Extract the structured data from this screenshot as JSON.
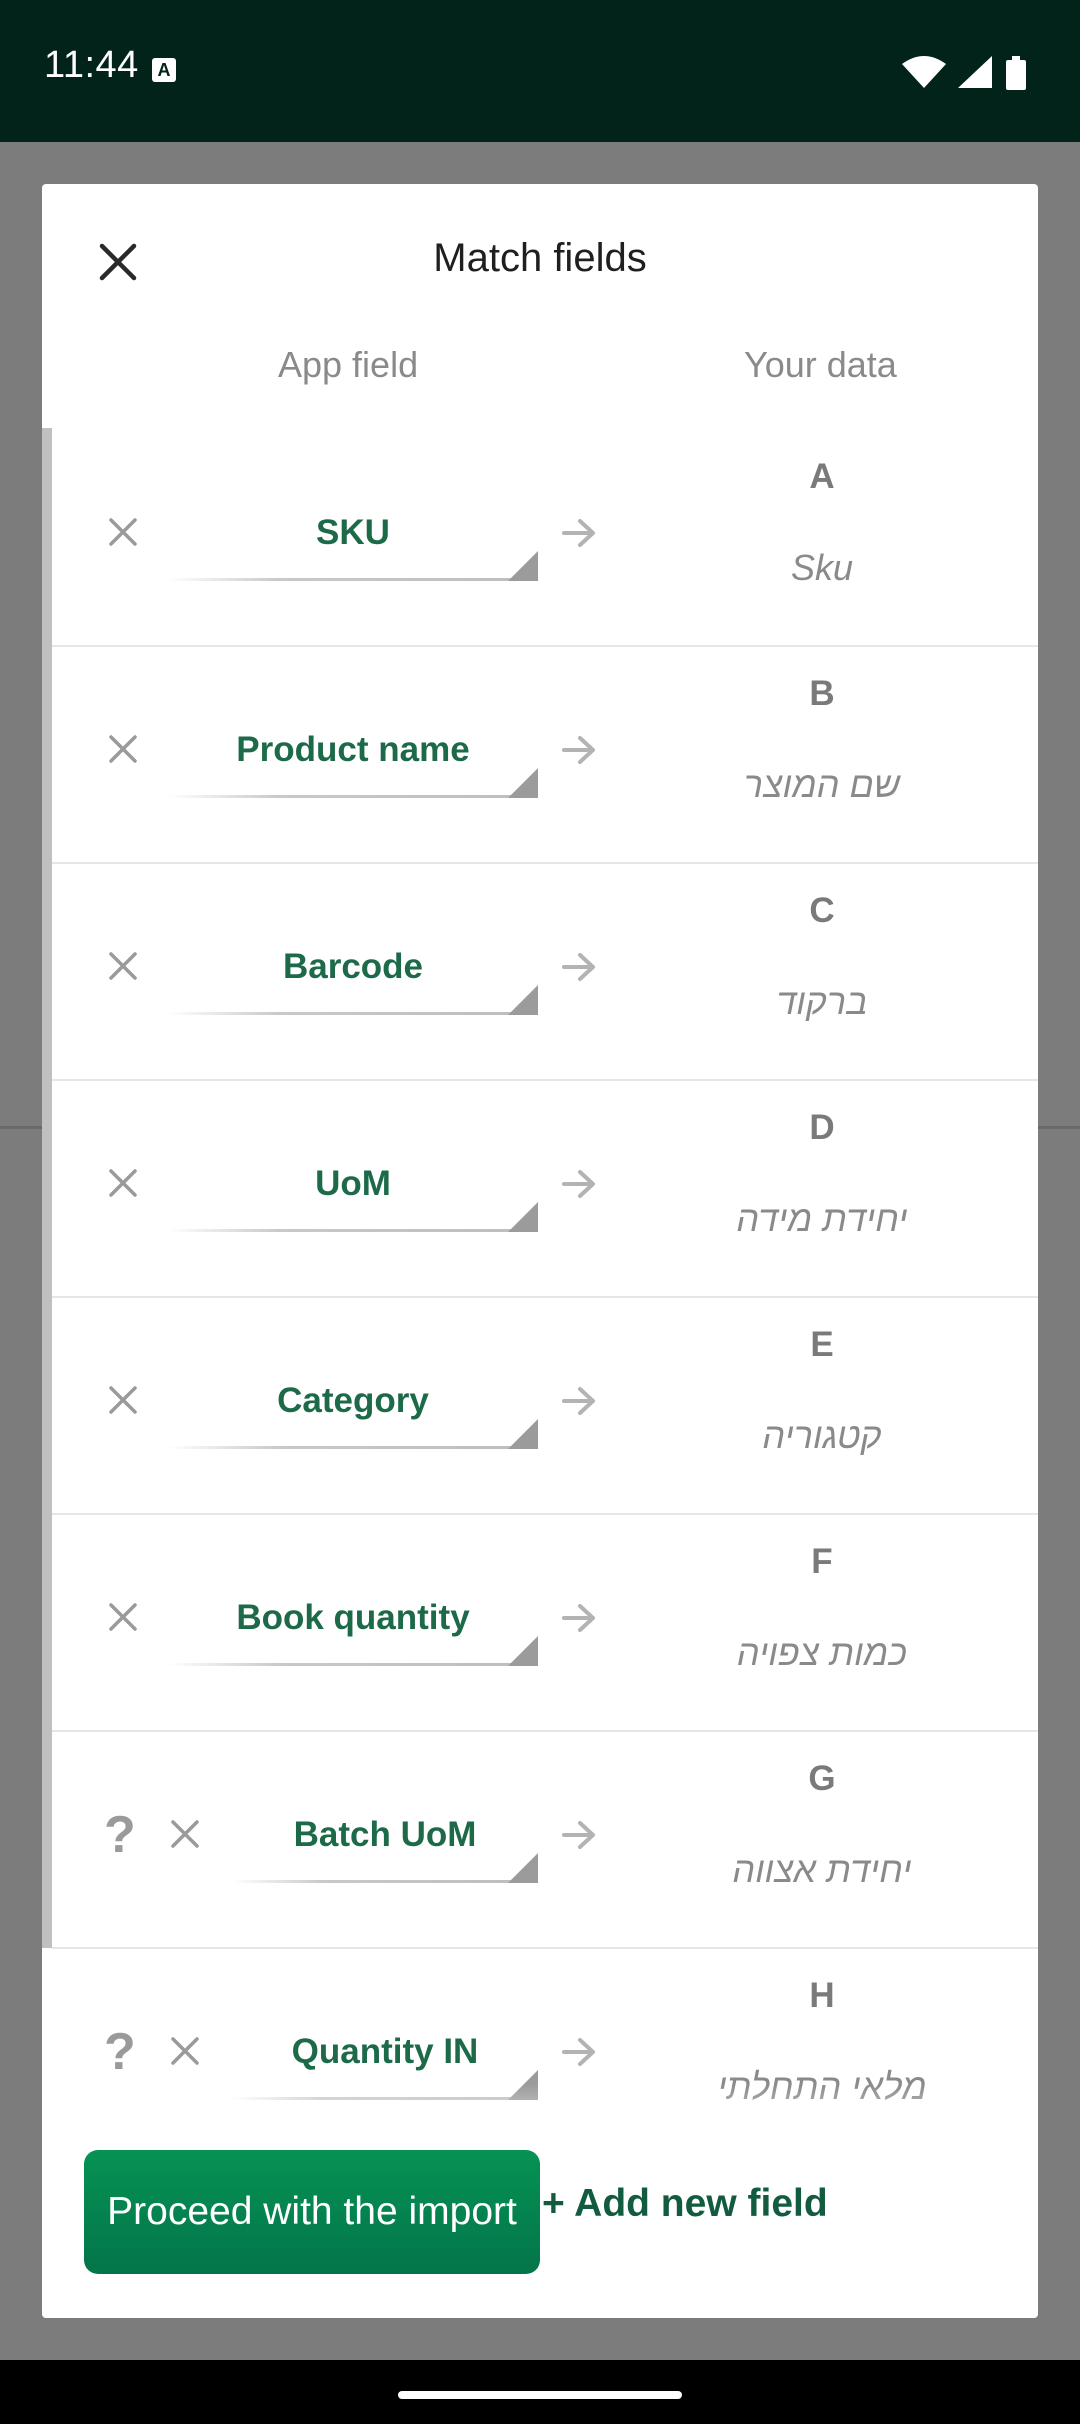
{
  "status_bar": {
    "time": "11:44",
    "notification_icon": "A-icon",
    "icons": [
      "wifi-icon",
      "cell-signal-icon",
      "battery-icon"
    ]
  },
  "dialog": {
    "title": "Match fields",
    "close_icon": "close-icon",
    "column_app_field": "App field",
    "column_your_data": "Your data"
  },
  "rows": [
    {
      "app_field": "SKU",
      "column": "A",
      "sample": "Sku",
      "help": false
    },
    {
      "app_field": "Product name",
      "column": "B",
      "sample": "שם המוצר",
      "help": false
    },
    {
      "app_field": "Barcode",
      "column": "C",
      "sample": "ברקוד",
      "help": false
    },
    {
      "app_field": "UoM",
      "column": "D",
      "sample": "יחידת מידה",
      "help": false
    },
    {
      "app_field": "Category",
      "column": "E",
      "sample": "קטגוריה",
      "help": false
    },
    {
      "app_field": "Book quantity",
      "column": "F",
      "sample": "כמות צפויה",
      "help": false
    },
    {
      "app_field": "Batch UoM",
      "column": "G",
      "sample": "יחידת אצווה",
      "help": true
    },
    {
      "app_field": "Quantity IN",
      "column": "H",
      "sample": "מלאי התחלתי",
      "help": true
    }
  ],
  "help_symbol": "?",
  "footer": {
    "proceed_label": "Proceed with the import",
    "add_field_label": "+ Add new field"
  },
  "colors": {
    "accent_green": "#069254",
    "field_text_green": "#1d6a49",
    "status_bar_bg": "#01231a"
  }
}
